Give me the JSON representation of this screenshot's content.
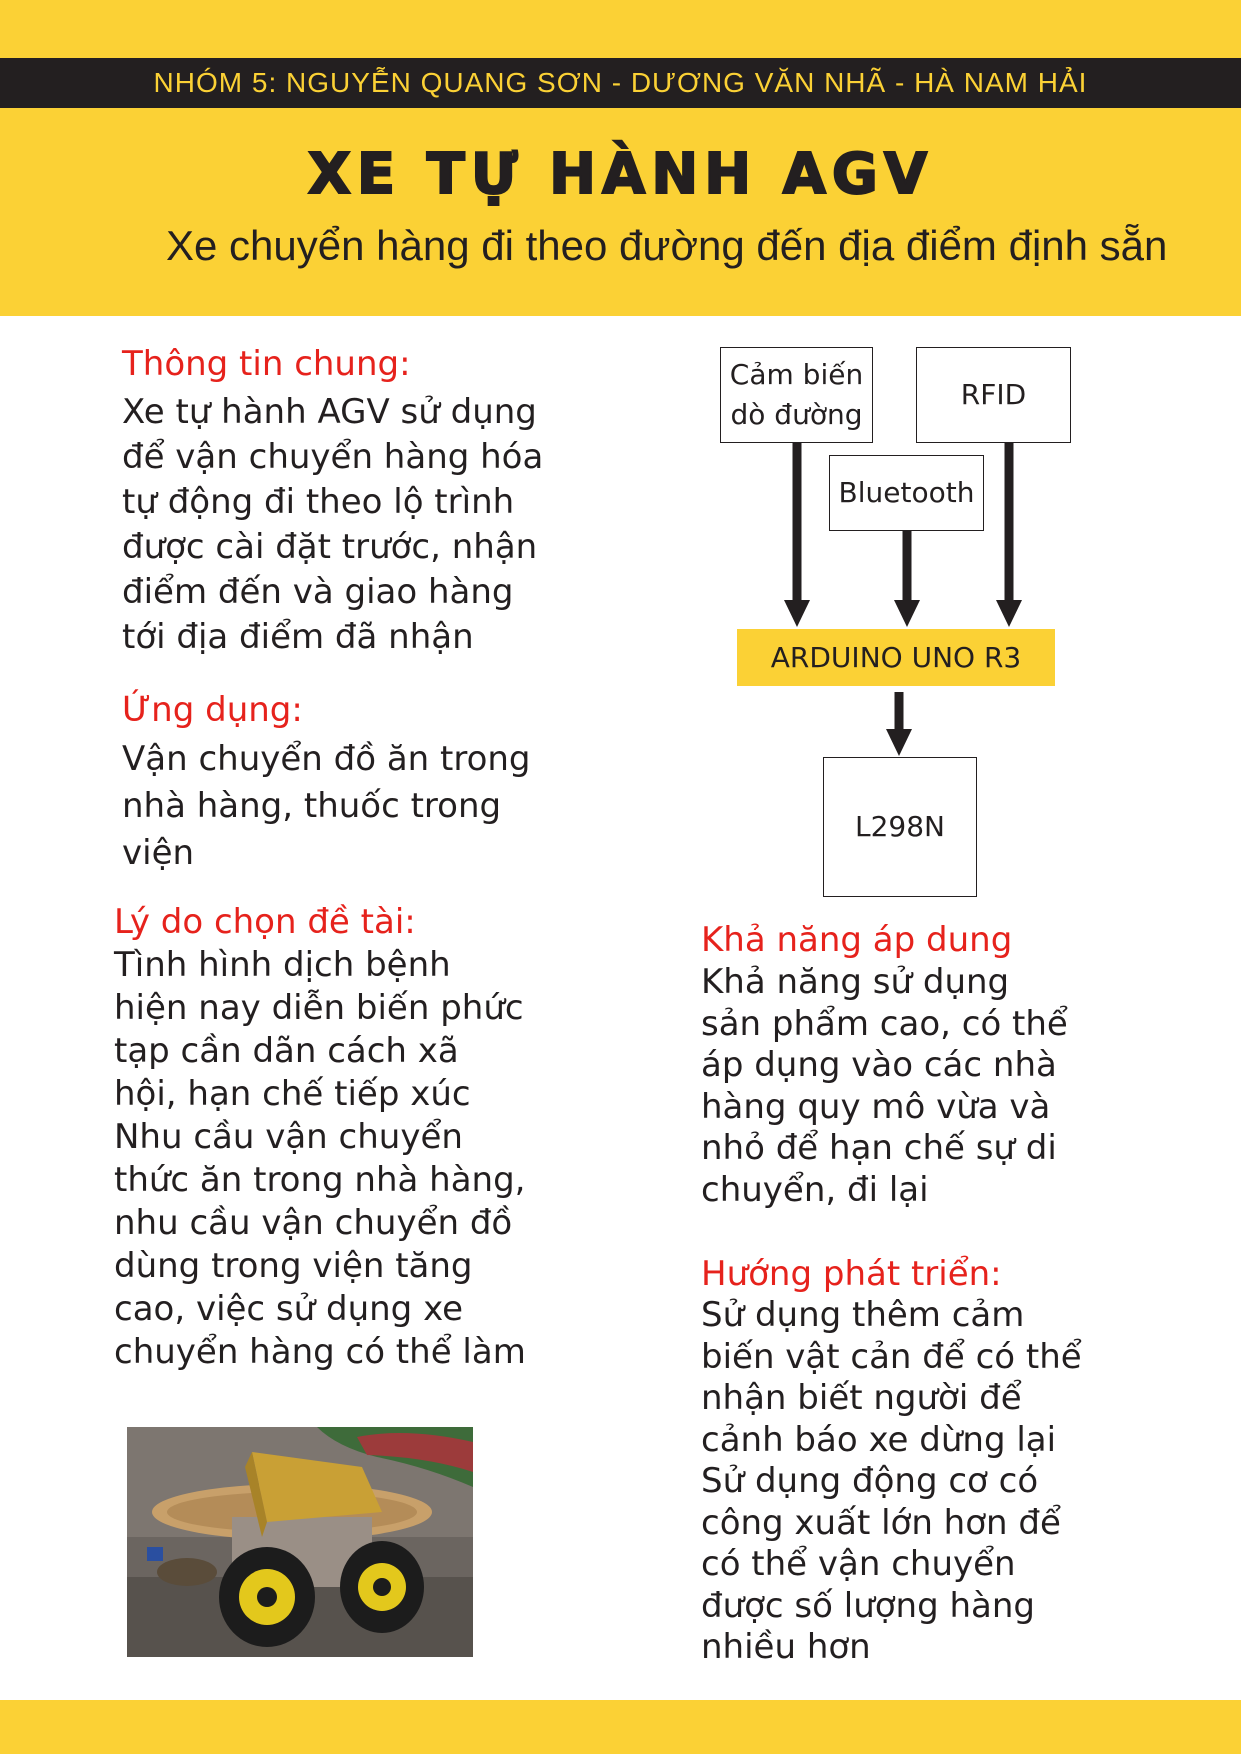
{
  "header": {
    "authors": "NHÓM 5: NGUYỄN QUANG SƠN - DƯƠNG VĂN NHÃ - HÀ NAM HẢI",
    "title": "XE TỰ HÀNH AGV",
    "subtitle": "Xe chuyển hàng đi theo đường đến địa điểm định sẵn"
  },
  "left": {
    "general": {
      "heading": "Thông tin chung:",
      "lines": [
        "Xe tự hành AGV sử dụng",
        "để vận chuyển hàng hóa",
        "tự động đi theo lộ trình",
        "được cài đặt trước, nhận",
        "điểm đến và giao hàng",
        "tới địa điểm đã nhận"
      ]
    },
    "application": {
      "heading": "Ứng dụng:",
      "lines": [
        "Vận chuyển đồ ăn trong",
        "nhà hàng, thuốc trong",
        "viện"
      ]
    },
    "reason": {
      "heading": "Lý do chọn đề tài:",
      "lines": [
        " Tình hình dịch bệnh",
        "hiện nay diễn biến phức",
        "tạp cần dãn cách xã",
        "hội, hạn chế tiếp xúc",
        "Nhu cầu vận chuyển",
        "thức ăn trong nhà hàng,",
        "nhu cầu vận chuyển đồ",
        "dùng trong viện tăng",
        "cao, việc sử dụng xe",
        "chuyển hàng có thể làm"
      ]
    }
  },
  "diagram": {
    "sensor_line1": "Cảm biến",
    "sensor_line2": "dò đường",
    "rfid": "RFID",
    "bluetooth": "Bluetooth",
    "controller": "ARDUINO UNO R3",
    "driver": "L298N"
  },
  "right": {
    "applicability": {
      "heading": "Khả năng áp dung",
      "lines": [
        " Khả năng sử dụng",
        "sản phẩm cao, có thể",
        "áp dụng vào các nhà",
        "hàng quy mô vừa và",
        "nhỏ để hạn chế sự di",
        "chuyển, đi lại"
      ]
    },
    "development": {
      "heading": "Hướng phát triển:",
      "lines": [
        "Sử dụng thêm cảm",
        "biến vật cản để có thể",
        "nhận biết người để",
        "cảnh báo xe dừng lại",
        "Sử dụng động cơ có",
        "công xuất lớn hơn để",
        "có thể vận chuyển",
        "được số lượng hàng",
        "nhiều hơn"
      ]
    }
  },
  "colors": {
    "accent_yellow": "#fbd135",
    "dark": "#231f20",
    "heading_red": "#e6221c"
  }
}
